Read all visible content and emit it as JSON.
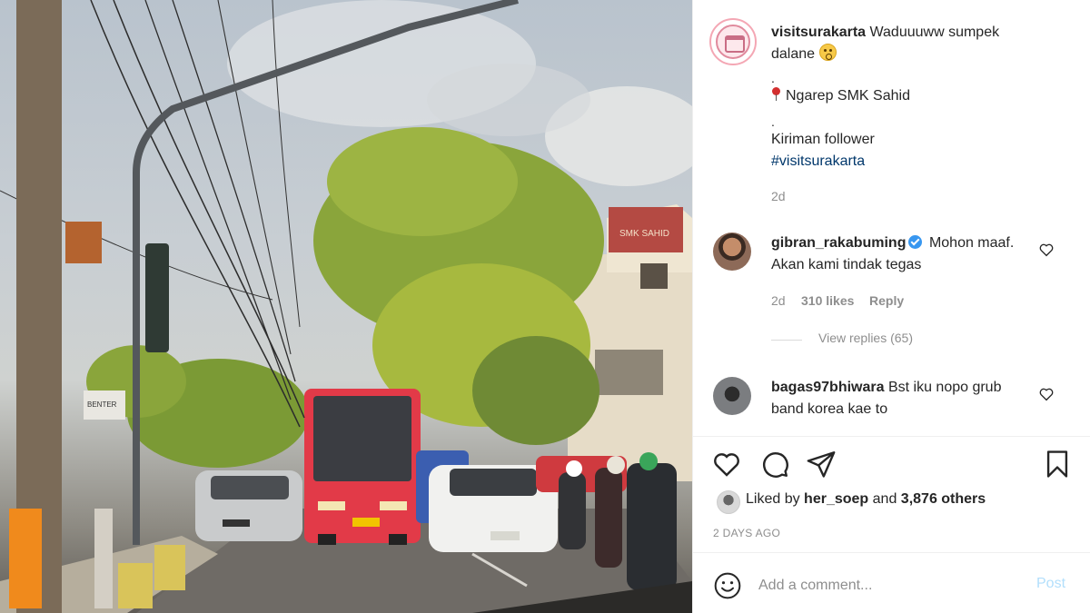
{
  "post": {
    "username": "visitsurakarta",
    "caption_text": "Waduuuww sumpek dalane",
    "dot1": ".",
    "location_line": "Ngarep SMK Sahid",
    "dot2": ".",
    "follower_line": "Kiriman follower",
    "hashtag": "#visitsurakarta",
    "age": "2d"
  },
  "comments": [
    {
      "username": "gibran_rakabuming",
      "text": "Mohon maaf. Akan kami tindak tegas",
      "age": "2d",
      "likes": "310 likes",
      "reply_label": "Reply",
      "view_replies": "View replies (65)"
    },
    {
      "username": "bagas97bhiwara",
      "text": "Bst iku nopo grub band korea kae to"
    }
  ],
  "engagement": {
    "liked_by_prefix": "Liked by",
    "liked_by_user": "her_soep",
    "liked_by_suffix": "and",
    "others": "3,876 others",
    "date": "2 DAYS AGO"
  },
  "composer": {
    "placeholder": "Add a comment...",
    "post_label": "Post"
  },
  "photo_signs": {
    "building_sign": "SMK SAHID",
    "shop_sign": "BENTER"
  },
  "icons": {
    "like": "heart-icon",
    "comment": "comment-bubble-icon",
    "share": "paper-plane-icon",
    "save": "bookmark-icon",
    "emoji": "smiley-icon",
    "verified": "verified-badge-icon",
    "location": "pin-icon"
  },
  "colors": {
    "link": "#00376b",
    "muted": "#8e8e8e",
    "post_disabled": "#b2dffc",
    "verified": "#3897f0"
  }
}
